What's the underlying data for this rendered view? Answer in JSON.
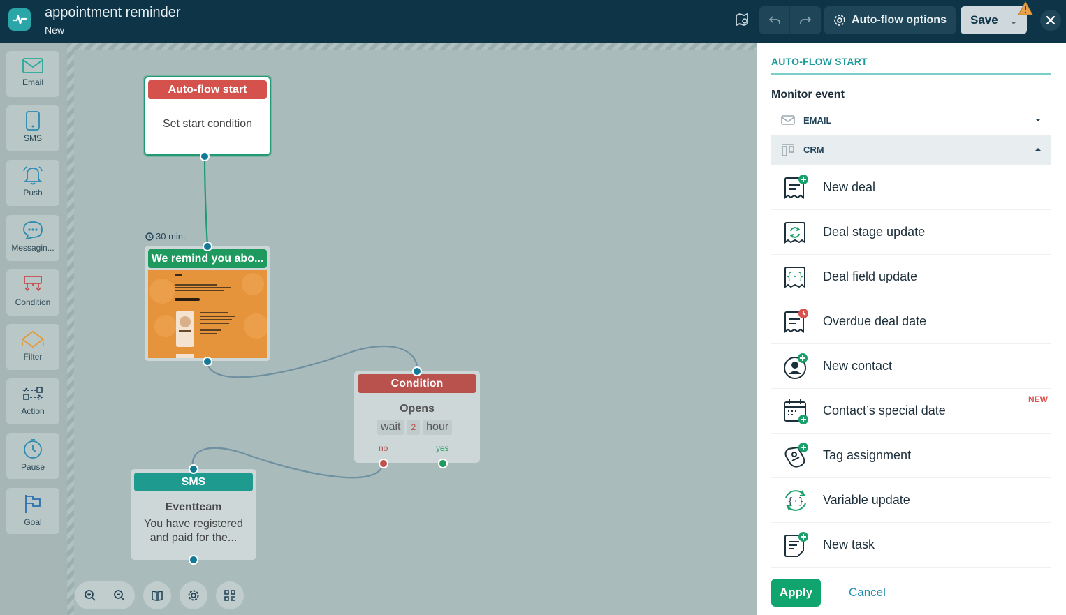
{
  "header": {
    "title": "appointment reminder",
    "subtitle": "New",
    "autoflow_options_label": "Auto-flow options",
    "save_label": "Save"
  },
  "toolbox": {
    "items": [
      {
        "label": "Email",
        "icon": "envelope-icon"
      },
      {
        "label": "SMS",
        "icon": "phone-icon"
      },
      {
        "label": "Push",
        "icon": "bell-icon"
      },
      {
        "label": "Messagin...",
        "icon": "chat-bubble-icon"
      },
      {
        "label": "Condition",
        "icon": "branch-icon"
      },
      {
        "label": "Filter",
        "icon": "funnel-icon"
      },
      {
        "label": "Action",
        "icon": "arrows-icon"
      },
      {
        "label": "Pause",
        "icon": "clock-icon"
      },
      {
        "label": "Goal",
        "icon": "flag-icon"
      }
    ]
  },
  "canvas": {
    "start_node": {
      "header": "Auto-flow start",
      "body": "Set start condition"
    },
    "timer_label": "30 min.",
    "email_node": {
      "header": "We remind you abo..."
    },
    "condition_node": {
      "header": "Condition",
      "title": "Opens",
      "wait_label": "wait",
      "wait_value": "2",
      "wait_unit": "hour",
      "no_label": "no",
      "yes_label": "yes"
    },
    "sms_node": {
      "header": "SMS",
      "title": "Eventteam",
      "body": "You have registered and paid for the..."
    }
  },
  "panel": {
    "title": "AUTO-FLOW START",
    "monitor_label": "Monitor event",
    "category_email": "EMAIL",
    "category_crm": "CRM",
    "items": [
      {
        "label": "New deal"
      },
      {
        "label": "Deal stage update"
      },
      {
        "label": "Deal field update"
      },
      {
        "label": "Overdue deal date"
      },
      {
        "label": "New contact"
      },
      {
        "label": "Contact’s special date",
        "badge": "NEW"
      },
      {
        "label": "Tag assignment"
      },
      {
        "label": "Variable update"
      },
      {
        "label": "New task"
      }
    ],
    "apply_label": "Apply",
    "cancel_label": "Cancel"
  },
  "colors": {
    "header_bg": "#0e3447",
    "accent_teal": "#1d9a9a",
    "start_red": "#d4524b",
    "email_green": "#1f9a5f",
    "apply_green": "#10a56f",
    "port_blue": "#137a96"
  }
}
